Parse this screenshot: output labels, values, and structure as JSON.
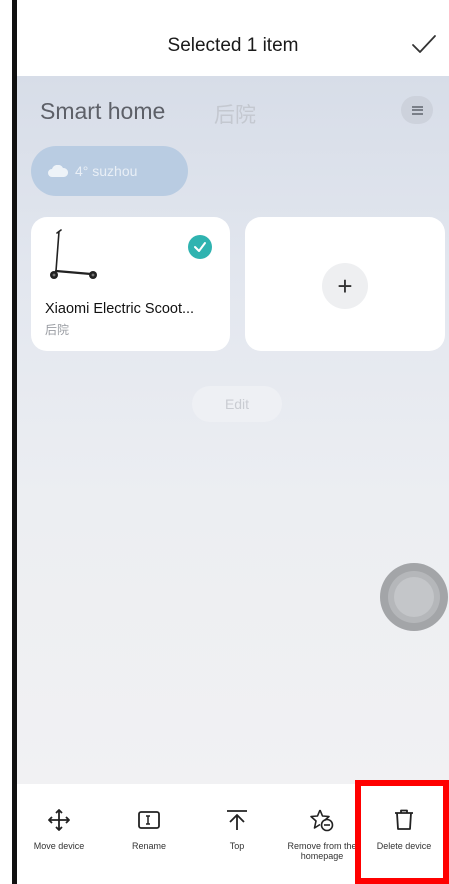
{
  "header": {
    "title": "Selected 1 item",
    "confirm_icon": "checkmark-icon"
  },
  "home": {
    "title": "Smart home",
    "room_tab": "后院",
    "menu_icon": "hamburger-icon"
  },
  "weather": {
    "icon": "cloud-icon",
    "text": "4° suzhou"
  },
  "devices": [
    {
      "name": "Xiaomi Electric Scoot...",
      "room": "后院",
      "selected": true,
      "icon": "scooter-icon"
    }
  ],
  "add_card": {
    "icon": "plus-icon",
    "text": "+"
  },
  "edit_label": "Edit",
  "actions": [
    {
      "label": "Move device",
      "icon": "move-arrows-icon"
    },
    {
      "label": "Rename",
      "icon": "rename-icon"
    },
    {
      "label": "Top",
      "icon": "pin-top-icon"
    },
    {
      "label": "Remove from the homepage",
      "icon": "remove-star-icon"
    },
    {
      "label": "Delete device",
      "icon": "trash-icon"
    }
  ],
  "colors": {
    "accent_teal": "#2fb3b0",
    "highlight_red": "#ff0000"
  }
}
